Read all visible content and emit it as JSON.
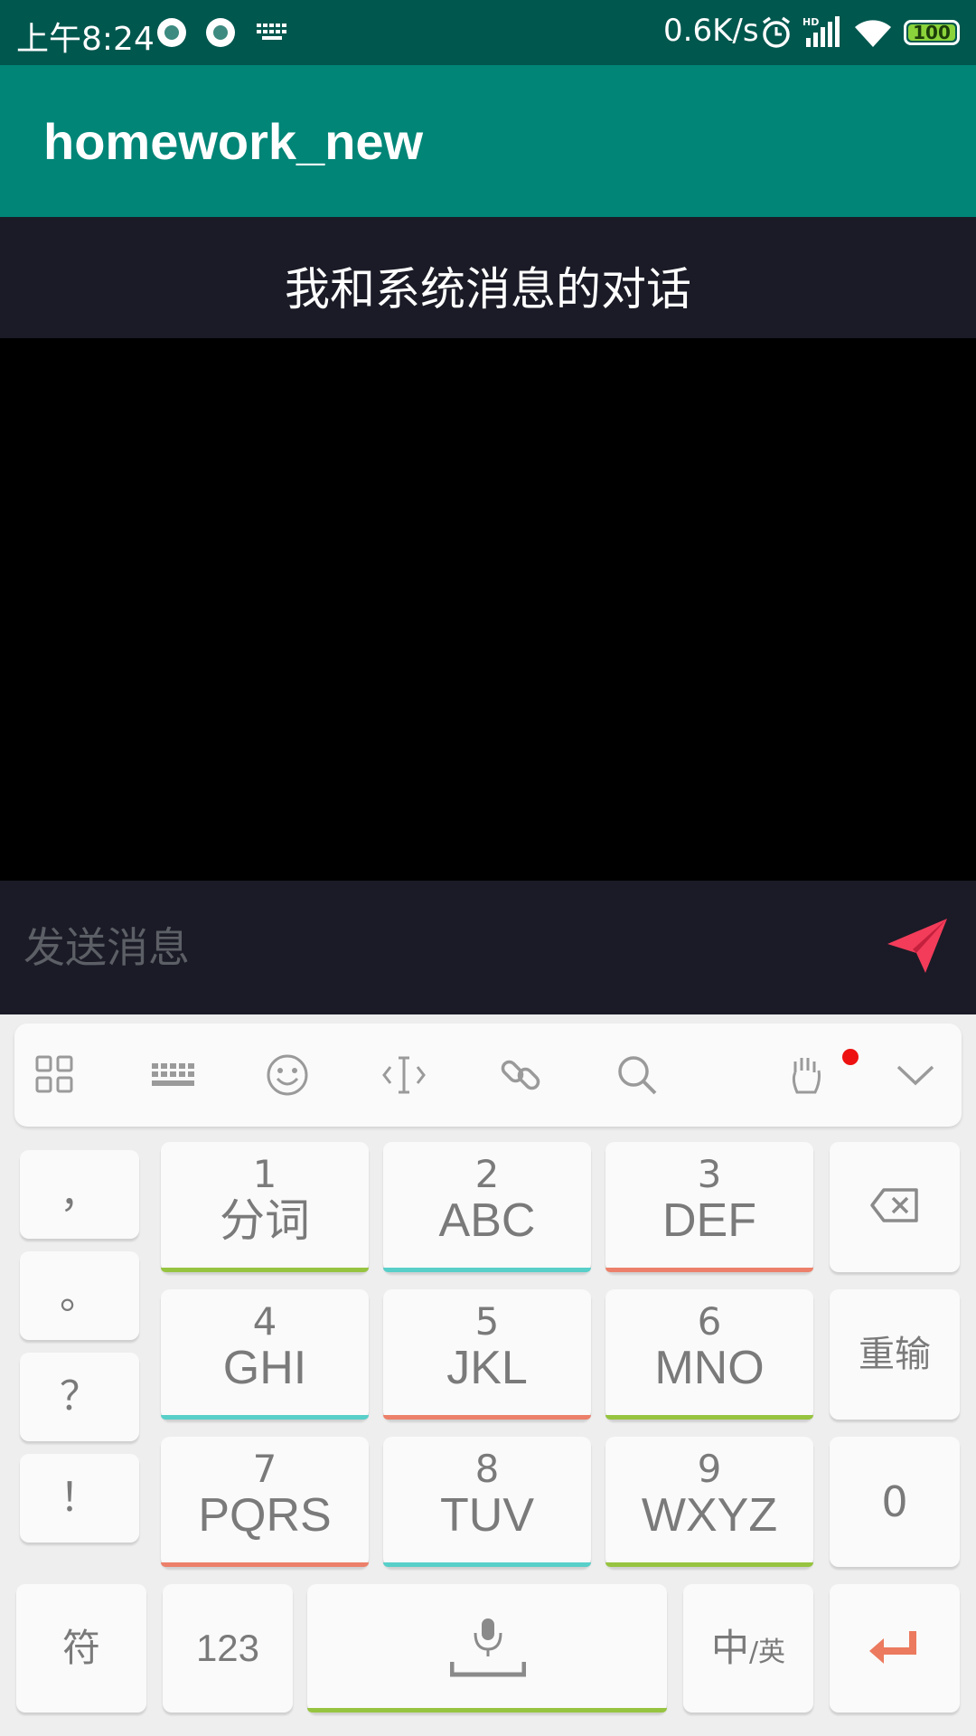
{
  "status_bar": {
    "time": "上午8:24",
    "net_speed": "0.6K/s",
    "signal_label": "HD",
    "battery": "100"
  },
  "app": {
    "title": "homework_new"
  },
  "chat": {
    "title": "我和系统消息的对话",
    "input_placeholder": "发送消息"
  },
  "keyboard": {
    "toolbar": [
      "apps-grid-icon",
      "keyboard-icon",
      "emoji-icon",
      "cursor-icon",
      "link-icon",
      "search-icon",
      "hand-icon",
      "collapse-icon"
    ],
    "punctuation": [
      "，",
      "。",
      "？",
      "！"
    ],
    "keys": [
      {
        "num": "1",
        "letters": "分词"
      },
      {
        "num": "2",
        "letters": "ABC"
      },
      {
        "num": "3",
        "letters": "DEF"
      },
      {
        "num": "4",
        "letters": "GHI"
      },
      {
        "num": "5",
        "letters": "JKL"
      },
      {
        "num": "6",
        "letters": "MNO"
      },
      {
        "num": "7",
        "letters": "PQRS"
      },
      {
        "num": "8",
        "letters": "TUV"
      },
      {
        "num": "9",
        "letters": "WXYZ"
      }
    ],
    "reinput": "重输",
    "zero": "0",
    "symbols": "符",
    "numbers": "123",
    "lang_main": "中",
    "lang_sub": "/英"
  },
  "colors": {
    "status_bar": "#00574e",
    "app_bar": "#008577",
    "chat_header": "#1a1b26",
    "send_icon": "#f23c5a",
    "enter_icon": "#ec7a5e"
  }
}
